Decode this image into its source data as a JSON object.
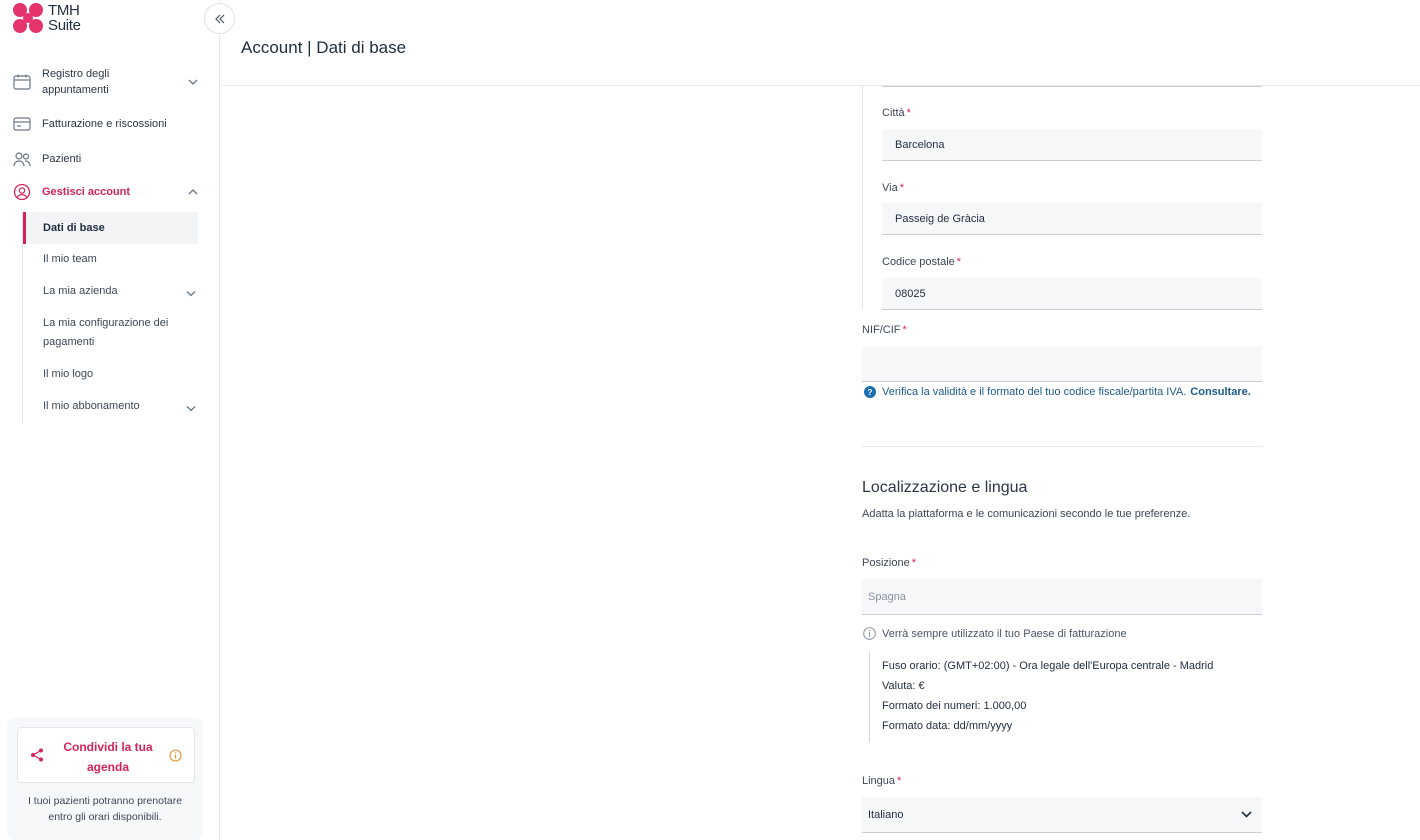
{
  "brand": {
    "name_line1": "TMH",
    "name_line2": "Suite",
    "accent": "#d6245a"
  },
  "sidebar": {
    "items": [
      {
        "label": "Registro degli appuntamenti",
        "icon": "calendar-icon"
      },
      {
        "label": "Fatturazione e riscossioni",
        "icon": "card-icon"
      },
      {
        "label": "Pazienti",
        "icon": "users-icon"
      },
      {
        "label": "Gestisci account",
        "icon": "user-circle-icon"
      }
    ],
    "subitems": [
      {
        "label": "Dati di base"
      },
      {
        "label": "Il mio team"
      },
      {
        "label": "La mia azienda"
      },
      {
        "label": "La mia configurazione dei pagamenti"
      },
      {
        "label": "Il mio logo"
      },
      {
        "label": "Il mio abbonamento"
      }
    ],
    "share": {
      "label": "Condividi la tua agenda",
      "description": "I tuoi pazienti potranno prenotare entro gli orari disponibili."
    }
  },
  "header": {
    "title": "Account | Dati di base"
  },
  "form": {
    "city": {
      "label": "Città",
      "value": "Barcelona"
    },
    "street": {
      "label": "Via",
      "value": "Passeig de Gràcia"
    },
    "postal": {
      "label": "Codice postale",
      "value": "08025"
    },
    "nif": {
      "label": "NIF/CIF",
      "value": ""
    },
    "help_text": "Verifica la validità e il formato del tuo codice fiscale/partita IVA.",
    "help_link": "Consultare."
  },
  "localization": {
    "title": "Localizzazione e lingua",
    "description": "Adatta la piattaforma e le comunicazioni secondo le tue preferenze.",
    "position": {
      "label": "Posizione",
      "placeholder": "Spagna"
    },
    "note": "Verrà sempre utilizzato il tuo Paese di fatturazione",
    "details": [
      {
        "key": "Fuso orario:",
        "value": "(GMT+02:00) - Ora legale dell'Europa centrale - Madrid"
      },
      {
        "key": "Valuta:",
        "value": "€"
      },
      {
        "key": "Formato dei numeri:",
        "value": "1.000,00"
      },
      {
        "key": "Formato data:",
        "value": "dd/mm/yyyy"
      }
    ],
    "language": {
      "label": "Lingua",
      "value": "Italiano"
    }
  }
}
